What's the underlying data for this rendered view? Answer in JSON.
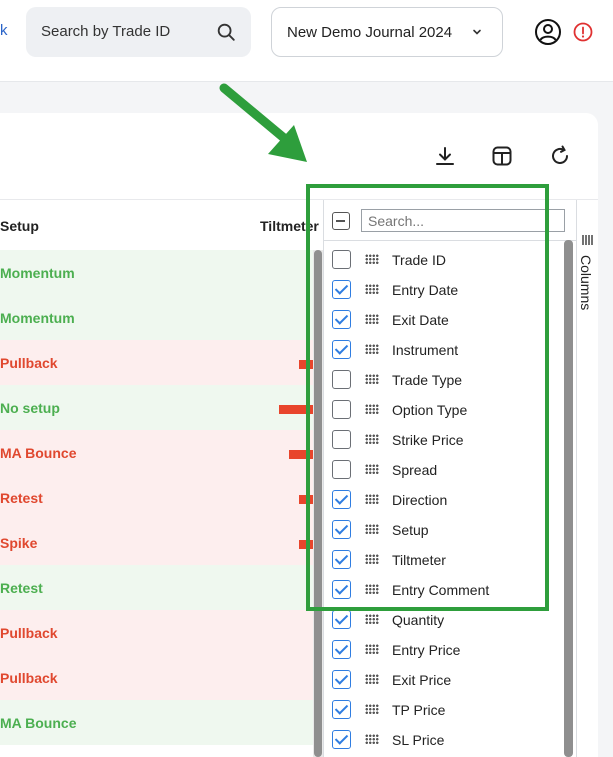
{
  "header": {
    "edge_text": "k",
    "search_placeholder": "Search by Trade ID",
    "journal_name": "New Demo Journal 2024"
  },
  "icons": [
    "search-icon",
    "chevron-down-icon",
    "user-icon",
    "alert-icon",
    "download-icon",
    "layout-icon",
    "refresh-icon",
    "columns-icon"
  ],
  "grid": {
    "headers": {
      "setup": "Setup",
      "tiltmeter": "Tiltmeter"
    },
    "rows": [
      {
        "setup": "Momentum",
        "result": "win"
      },
      {
        "setup": "Momentum",
        "result": "win"
      },
      {
        "setup": "Pullback",
        "result": "loss"
      },
      {
        "setup": "No setup",
        "result": "win"
      },
      {
        "setup": "MA Bounce",
        "result": "loss"
      },
      {
        "setup": "Retest",
        "result": "loss"
      },
      {
        "setup": "Spike",
        "result": "loss"
      },
      {
        "setup": "Retest",
        "result": "win"
      },
      {
        "setup": "Pullback",
        "result": "loss"
      },
      {
        "setup": "Pullback",
        "result": "loss"
      },
      {
        "setup": "MA Bounce",
        "result": "win"
      }
    ]
  },
  "columns_panel": {
    "search_placeholder": "Search...",
    "tab_label": "Columns",
    "items": [
      {
        "label": "Trade ID",
        "checked": false
      },
      {
        "label": "Entry Date",
        "checked": true
      },
      {
        "label": "Exit Date",
        "checked": true
      },
      {
        "label": "Instrument",
        "checked": true
      },
      {
        "label": "Trade Type",
        "checked": false
      },
      {
        "label": "Option Type",
        "checked": false
      },
      {
        "label": "Strike Price",
        "checked": false
      },
      {
        "label": "Spread",
        "checked": false
      },
      {
        "label": "Direction",
        "checked": true
      },
      {
        "label": "Setup",
        "checked": true
      },
      {
        "label": "Tiltmeter",
        "checked": true
      },
      {
        "label": "Entry Comment",
        "checked": true
      },
      {
        "label": "Quantity",
        "checked": true
      },
      {
        "label": "Entry Price",
        "checked": true
      },
      {
        "label": "Exit Price",
        "checked": true
      },
      {
        "label": "TP Price",
        "checked": true
      },
      {
        "label": "SL Price",
        "checked": true
      }
    ]
  },
  "colors": {
    "highlight": "#2e9e3c",
    "win": "#4caf50",
    "loss": "#e0482f",
    "checkbox": "#2f7de1"
  }
}
